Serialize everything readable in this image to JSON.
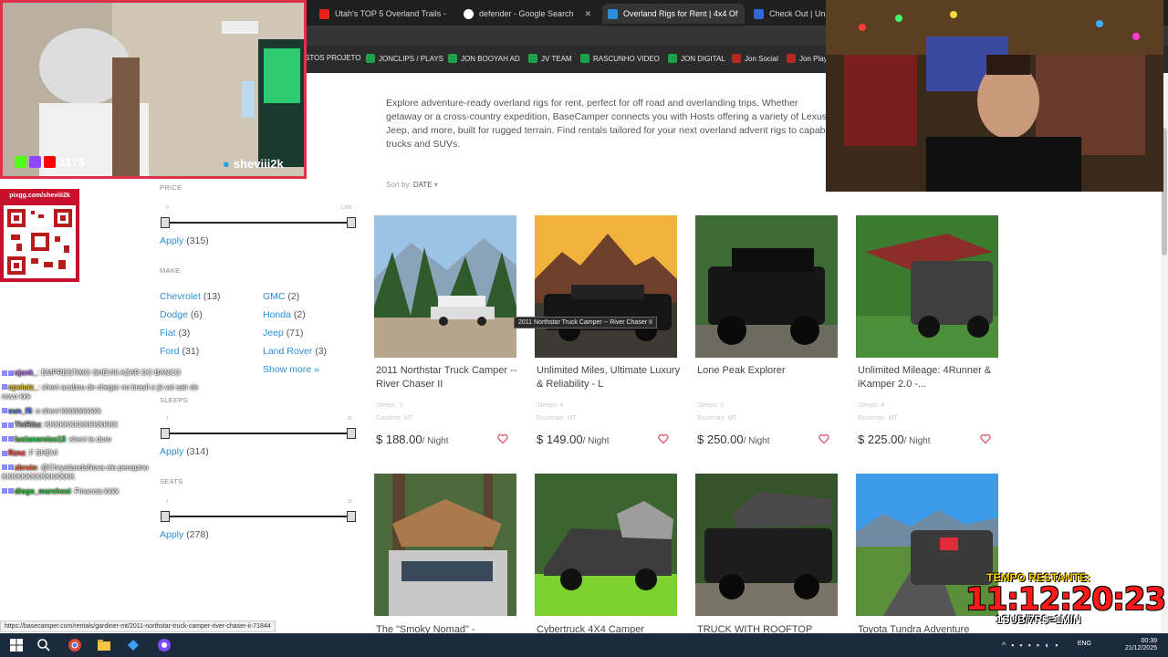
{
  "browser": {
    "tabs": [
      {
        "label": "Utah's TOP 5 Overland Trails - ",
        "color": "#e62117",
        "active": false
      },
      {
        "label": "defender - Google Search",
        "color": "#4285f4",
        "active": false
      },
      {
        "label": "Overland Rigs for Rent | 4x4 Of",
        "color": "#2a8fd6",
        "active": true
      },
      {
        "label": "Check Out | Unite",
        "color": "#3367d6",
        "active": false
      }
    ],
    "bookmarks": [
      {
        "label": "STOS PROJETO",
        "color": ""
      },
      {
        "label": "JONCLIPS / PLAYS",
        "color": "#1ea14b"
      },
      {
        "label": "JON BOOYAH AD",
        "color": "#1ea14b"
      },
      {
        "label": "JV TEAM",
        "color": "#1ea14b"
      },
      {
        "label": "RASCUNHO VIDEO",
        "color": "#1ea14b"
      },
      {
        "label": "JON DIGITAL",
        "color": "#1ea14b"
      },
      {
        "label": "Jon Social",
        "color": "#b5271f"
      },
      {
        "label": "Jon Play",
        "color": "#b5271f"
      }
    ],
    "status_url": "https://basecamper.com/rentals/gardiner-mt/2011-northstar-truck-camper-river-chaser-ii-71844"
  },
  "page": {
    "intro": "Explore adventure-ready overland rigs for rent, perfect for off road and overlanding trips. Whether getaway or a cross-country expedition, BaseCamper connects you with Hosts offering a variety of Lexus, Jeep, and more, built for rugged terrain. Find rentals tailored for your next overland advent rigs to capable trucks and SUVs.",
    "sort_label": "Sort by:",
    "sort_value": "DATE",
    "filters": {
      "price": {
        "heading": "PRICE",
        "min": "0",
        "max": "1,000",
        "apply": "Apply",
        "count": "(315)"
      },
      "make": {
        "heading": "MAKE",
        "items": [
          {
            "name": "Chevrolet",
            "count": "(13)"
          },
          {
            "name": "GMC",
            "count": "(2)"
          },
          {
            "name": "Dodge",
            "count": "(6)"
          },
          {
            "name": "Honda",
            "count": "(2)"
          },
          {
            "name": "Fiat",
            "count": "(3)"
          },
          {
            "name": "Jeep",
            "count": "(71)"
          },
          {
            "name": "Ford",
            "count": "(31)"
          },
          {
            "name": "Land Rover",
            "count": "(3)"
          }
        ],
        "show_more": "Show more »"
      },
      "sleeps": {
        "heading": "SLEEPS",
        "min": "1",
        "max": "10",
        "apply": "Apply",
        "count": "(314)"
      },
      "seats": {
        "heading": "SEATS",
        "min": "1",
        "max": "15",
        "apply": "Apply",
        "count": "(278)"
      }
    },
    "listings": [
      {
        "title": "2011 Northstar Truck Camper -- River Chaser II",
        "sleeps": "Sleeps: 3",
        "location": "Gardiner, MT",
        "price": "$ 188.00",
        "unit": "/ Night"
      },
      {
        "title": "Unlimited Miles, Ultimate Luxury & Reliability - L",
        "sleeps": "Sleeps: 4",
        "location": "Bozeman, MT",
        "price": "$ 149.00",
        "unit": "/ Night"
      },
      {
        "title": "Lone Peak Explorer",
        "sleeps": "Sleeps: 2",
        "location": "Bozeman, MT",
        "price": "$ 250.00",
        "unit": "/ Night"
      },
      {
        "title": "Unlimited Mileage: 4Runner & iKamper 2.0 -...",
        "sleeps": "Sleeps: 4",
        "location": "Bozeman, MT",
        "price": "$ 225.00",
        "unit": "/ Night"
      },
      {
        "title": "The \"Smoky Nomad\" -"
      },
      {
        "title": "Cybertruck 4X4 Camper"
      },
      {
        "title": "TRUCK WITH ROOFTOP"
      },
      {
        "title": "Toyota Tundra Adventure"
      }
    ],
    "tooltip": "2011 Northstar Truck Camper -- River Chaser II"
  },
  "stream": {
    "viewers": "3175",
    "handle": "sheviii2k",
    "qr_label": "pixgg.com/sheviii2k",
    "chat": [
      {
        "user": "cjank_",
        "text": ": EMPRESTIMO SHEVIII AZAR DO BANCO",
        "color": "#b36bff"
      },
      {
        "user": "opelutz_",
        "text": ": shevi acabou de chegar no brasil e já vai sair de novo kkk",
        "color": "#e6c229"
      },
      {
        "user": "sun_f5",
        "text": ": o shevi kkkkkkkkkkk",
        "color": "#5b7bff"
      },
      {
        "user": "ThiRibz",
        "text": ": KKKKKKKKKKKKKKK",
        "color": "#9aa0a6"
      },
      {
        "user": "lucianoreiss13",
        "text": ": shevi ta duro",
        "color": "#2ecc40"
      },
      {
        "user": "Rznz",
        "text": ": F SHEVI",
        "color": "#ff4d4d"
      },
      {
        "user": "zbruto",
        "text": ": @ChrystiandaNova ele penapino KKKKKKKKKKKKKKK",
        "color": "#ff6b3d"
      },
      {
        "user": "diogo_marchesi",
        "text": ": Financia kkkk",
        "color": "#2ecc40"
      }
    ],
    "timer_label": "TEMPO RESTANTE:",
    "timer": "11:12:20:23",
    "timer_rule": "1SUB/7R$=1MIN"
  },
  "taskbar": {
    "lang": "ENG",
    "time": "00:39",
    "date": "21/12/2025"
  }
}
